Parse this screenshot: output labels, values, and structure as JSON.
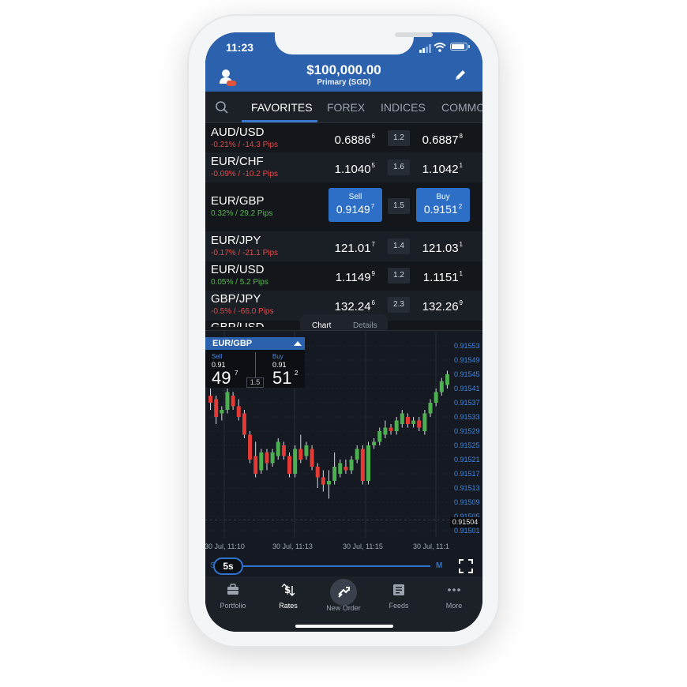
{
  "status_bar": {
    "time": "11:23"
  },
  "header": {
    "balance": "$100,000.00",
    "account": "Primary (SGD)"
  },
  "tabs": [
    {
      "label": "FAVORITES",
      "active": true
    },
    {
      "label": "FOREX",
      "active": false
    },
    {
      "label": "INDICES",
      "active": false
    },
    {
      "label": "COMMO",
      "active": false
    }
  ],
  "rates": [
    {
      "pair": "AUD/USD",
      "change": "-0.21% / -14.3 Pips",
      "direction": "neg",
      "sell": "0.6886",
      "sell_sup": "6",
      "spread": "1.2",
      "buy": "0.6887",
      "buy_sup": "8"
    },
    {
      "pair": "EUR/CHF",
      "change": "-0.09% / -10.2 Pips",
      "direction": "neg",
      "sell": "1.1040",
      "sell_sup": "5",
      "spread": "1.6",
      "buy": "1.1042",
      "buy_sup": "1"
    },
    {
      "pair": "EUR/GBP",
      "change": "0.32% / 29.2 Pips",
      "direction": "pos",
      "sell_label": "Sell",
      "buy_label": "Buy",
      "sell": "0.9149",
      "sell_sup": "7",
      "spread": "1.5",
      "buy": "0.9151",
      "buy_sup": "2",
      "expanded": true
    },
    {
      "pair": "EUR/JPY",
      "change": "-0.17% / -21.1 Pips",
      "direction": "neg",
      "sell": "121.01",
      "sell_sup": "7",
      "spread": "1.4",
      "buy": "121.03",
      "buy_sup": "1"
    },
    {
      "pair": "EUR/USD",
      "change": "0.05% / 5.2 Pips",
      "direction": "pos",
      "sell": "1.1149",
      "sell_sup": "9",
      "spread": "1.2",
      "buy": "1.1151",
      "buy_sup": "1"
    },
    {
      "pair": "GBP/JPY",
      "change": "-0.5% / -66.0 Pips",
      "direction": "neg",
      "sell": "132.24",
      "sell_sup": "6",
      "spread": "2.3",
      "buy": "132.26",
      "buy_sup": "9"
    },
    {
      "pair": "GBP/USD"
    }
  ],
  "chart_panel": {
    "tabs": [
      "Chart",
      "Details"
    ],
    "symbol": "EUR/GBP",
    "sell_label": "Sell",
    "buy_label": "Buy",
    "sell_prefix": "0.91",
    "sell_big": "49",
    "sell_sup": "7",
    "buy_prefix": "0.91",
    "buy_big": "51",
    "buy_sup": "2",
    "spread": "1.5",
    "last_price": "0.91504",
    "timeframe": "5s",
    "timeframe_min": "S",
    "timeframe_max": "M"
  },
  "chart_data": {
    "type": "candlestick",
    "y_ticks": [
      "0.91553",
      "0.91549",
      "0.91545",
      "0.91541",
      "0.91537",
      "0.91533",
      "0.91529",
      "0.91525",
      "0.91521",
      "0.91517",
      "0.91513",
      "0.91509",
      "0.91505",
      "0.91501"
    ],
    "ylim": [
      0.91499,
      0.91555
    ],
    "x_ticks": [
      "30 Jul, 11:10",
      "30 Jul, 11:13",
      "30 Jul, 11:15",
      "30 Jul, 11:1"
    ],
    "colors": {
      "up": "#4caf50",
      "down": "#e53935",
      "grid": "#262d38",
      "axis_text": "#3d86e0"
    },
    "candles": [
      {
        "o": 0.91539,
        "h": 0.91541,
        "l": 0.91535,
        "c": 0.91537
      },
      {
        "o": 0.91538,
        "h": 0.91539,
        "l": 0.91531,
        "c": 0.91533
      },
      {
        "o": 0.91534,
        "h": 0.91536,
        "l": 0.91532,
        "c": 0.91535
      },
      {
        "o": 0.91535,
        "h": 0.91541,
        "l": 0.91534,
        "c": 0.9154
      },
      {
        "o": 0.91539,
        "h": 0.9154,
        "l": 0.91535,
        "c": 0.91536
      },
      {
        "o": 0.91536,
        "h": 0.91538,
        "l": 0.91532,
        "c": 0.91533
      },
      {
        "o": 0.91534,
        "h": 0.91535,
        "l": 0.91527,
        "c": 0.91528
      },
      {
        "o": 0.91528,
        "h": 0.91529,
        "l": 0.9152,
        "c": 0.91521
      },
      {
        "o": 0.91522,
        "h": 0.91526,
        "l": 0.91516,
        "c": 0.91517
      },
      {
        "o": 0.91518,
        "h": 0.91524,
        "l": 0.91517,
        "c": 0.91523
      },
      {
        "o": 0.91523,
        "h": 0.91524,
        "l": 0.91518,
        "c": 0.9152
      },
      {
        "o": 0.9152,
        "h": 0.91524,
        "l": 0.91519,
        "c": 0.91523
      },
      {
        "o": 0.91522,
        "h": 0.91527,
        "l": 0.91521,
        "c": 0.91526
      },
      {
        "o": 0.91525,
        "h": 0.91526,
        "l": 0.91521,
        "c": 0.91522
      },
      {
        "o": 0.91522,
        "h": 0.91523,
        "l": 0.91516,
        "c": 0.91517
      },
      {
        "o": 0.91517,
        "h": 0.91525,
        "l": 0.91516,
        "c": 0.91524
      },
      {
        "o": 0.91524,
        "h": 0.91528,
        "l": 0.9152,
        "c": 0.91521
      },
      {
        "o": 0.91522,
        "h": 0.91526,
        "l": 0.91521,
        "c": 0.91525
      },
      {
        "o": 0.91524,
        "h": 0.91525,
        "l": 0.91518,
        "c": 0.91519
      },
      {
        "o": 0.91519,
        "h": 0.9152,
        "l": 0.91513,
        "c": 0.91516
      },
      {
        "o": 0.91516,
        "h": 0.91518,
        "l": 0.91512,
        "c": 0.91514
      },
      {
        "o": 0.91514,
        "h": 0.91518,
        "l": 0.9151,
        "c": 0.91515
      },
      {
        "o": 0.91515,
        "h": 0.91523,
        "l": 0.91514,
        "c": 0.91519
      },
      {
        "o": 0.91517,
        "h": 0.91521,
        "l": 0.91516,
        "c": 0.9152
      },
      {
        "o": 0.91519,
        "h": 0.91521,
        "l": 0.91517,
        "c": 0.91518
      },
      {
        "o": 0.91518,
        "h": 0.91522,
        "l": 0.91517,
        "c": 0.91521
      },
      {
        "o": 0.91521,
        "h": 0.91525,
        "l": 0.9152,
        "c": 0.91524
      },
      {
        "o": 0.91524,
        "h": 0.91525,
        "l": 0.91514,
        "c": 0.91515
      },
      {
        "o": 0.91515,
        "h": 0.91526,
        "l": 0.91514,
        "c": 0.91525
      },
      {
        "o": 0.91525,
        "h": 0.91527,
        "l": 0.91524,
        "c": 0.91526
      },
      {
        "o": 0.91526,
        "h": 0.9153,
        "l": 0.91525,
        "c": 0.91529
      },
      {
        "o": 0.91528,
        "h": 0.91532,
        "l": 0.91527,
        "c": 0.9153
      },
      {
        "o": 0.9153,
        "h": 0.91531,
        "l": 0.91528,
        "c": 0.91529
      },
      {
        "o": 0.91529,
        "h": 0.91533,
        "l": 0.91528,
        "c": 0.91532
      },
      {
        "o": 0.91531,
        "h": 0.91535,
        "l": 0.9153,
        "c": 0.91534
      },
      {
        "o": 0.91533,
        "h": 0.91534,
        "l": 0.9153,
        "c": 0.91531
      },
      {
        "o": 0.91531,
        "h": 0.91533,
        "l": 0.9153,
        "c": 0.91532
      },
      {
        "o": 0.91532,
        "h": 0.91533,
        "l": 0.91529,
        "c": 0.9153
      },
      {
        "o": 0.91529,
        "h": 0.91535,
        "l": 0.91528,
        "c": 0.91534
      },
      {
        "o": 0.91534,
        "h": 0.91538,
        "l": 0.91533,
        "c": 0.91537
      },
      {
        "o": 0.91537,
        "h": 0.91541,
        "l": 0.91536,
        "c": 0.9154
      },
      {
        "o": 0.9154,
        "h": 0.91544,
        "l": 0.91539,
        "c": 0.91543
      },
      {
        "o": 0.91542,
        "h": 0.91546,
        "l": 0.91541,
        "c": 0.91545
      }
    ]
  },
  "nav": [
    {
      "label": "Portfolio",
      "icon": "briefcase-icon",
      "active": false
    },
    {
      "label": "Rates",
      "icon": "rates-icon",
      "active": true
    },
    {
      "label": "New Order",
      "icon": "new-order-icon",
      "active": false
    },
    {
      "label": "Feeds",
      "icon": "feeds-icon",
      "active": false
    },
    {
      "label": "More",
      "icon": "more-icon",
      "active": false
    }
  ]
}
